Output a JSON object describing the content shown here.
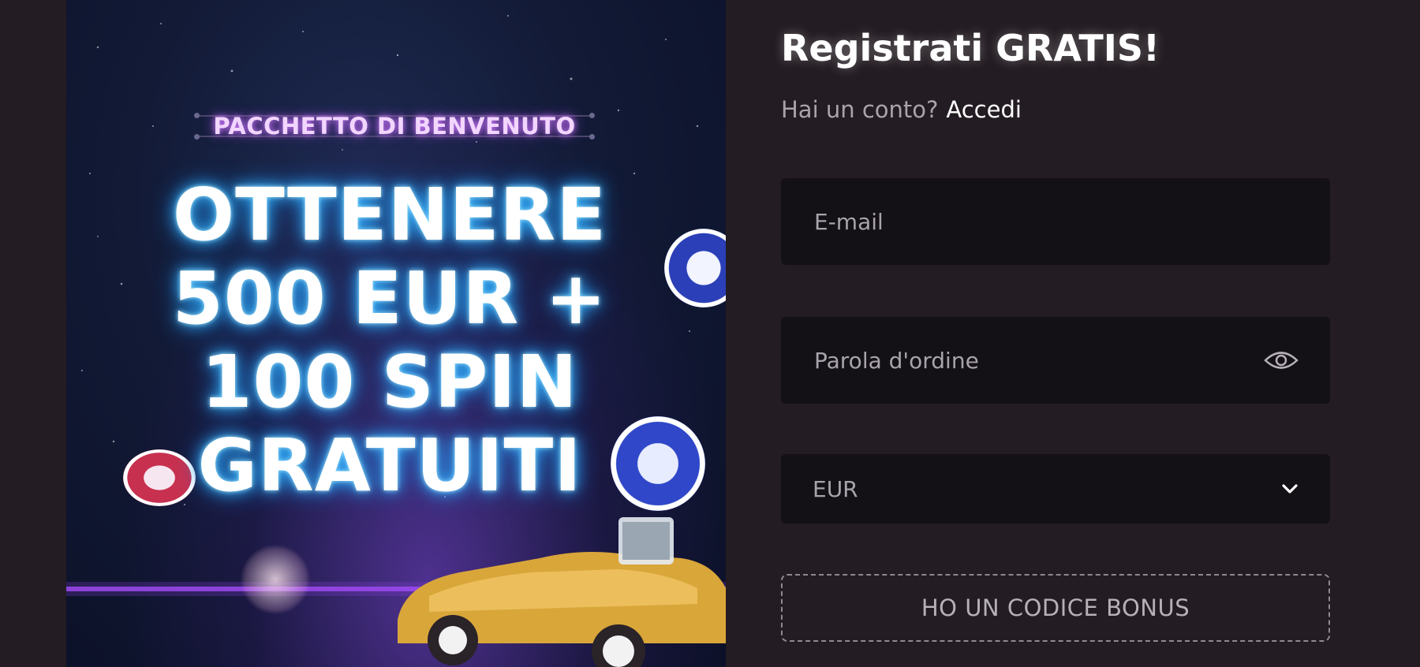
{
  "promo": {
    "eyebrow": "PACCHETTO DI BENVENUTO",
    "headline_lines": [
      "OTTENERE",
      "500 EUR +",
      "100 SPIN",
      "GRATUITI"
    ]
  },
  "form": {
    "title": "Registrati GRATIS!",
    "login_prompt": "Hai un conto?",
    "login_link": "Accedi",
    "email_placeholder": "E-mail",
    "password_placeholder": "Parola d'ordine",
    "currency_value": "EUR",
    "bonus_button": "HO UN CODICE BONUS"
  },
  "icons": {
    "password_toggle": "eye-icon",
    "currency_dropdown": "chevron-down-icon"
  },
  "colors": {
    "background": "#231c22",
    "field": "#131016",
    "text_muted": "#a9a3ab",
    "neon_blue": "#38b6ff",
    "neon_pink": "#d07cff"
  }
}
